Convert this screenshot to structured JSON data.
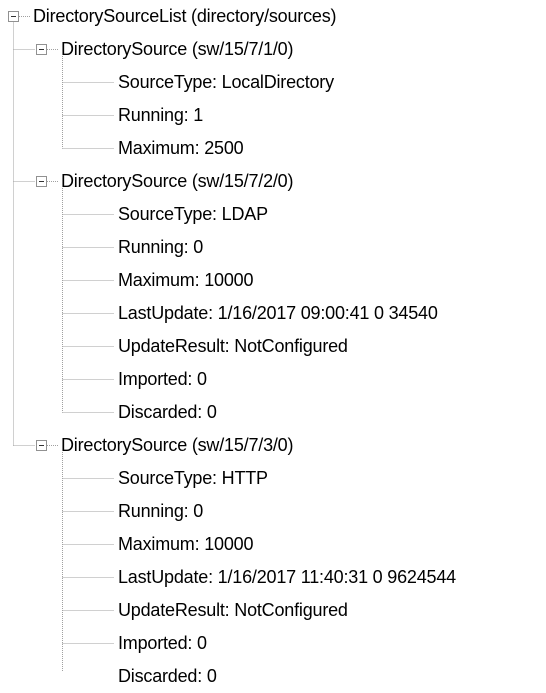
{
  "tree": {
    "root": {
      "label": "DirectorySourceList (directory/sources)",
      "children": [
        {
          "label": "DirectorySource (sw/15/7/1/0)",
          "children": [
            "SourceType: LocalDirectory",
            "Running: 1",
            "Maximum: 2500"
          ]
        },
        {
          "label": "DirectorySource (sw/15/7/2/0)",
          "children": [
            "SourceType: LDAP",
            "Running: 0",
            "Maximum: 10000",
            "LastUpdate: 1/16/2017 09:00:41 0 34540",
            "UpdateResult: NotConfigured",
            "Imported: 0",
            "Discarded: 0"
          ]
        },
        {
          "label": "DirectorySource (sw/15/7/3/0)",
          "children": [
            "SourceType: HTTP",
            "Running: 0",
            "Maximum: 10000",
            "LastUpdate: 1/16/2017 11:40:31 0 9624544",
            "UpdateResult: NotConfigured",
            "Imported: 0",
            "Discarded: 0"
          ]
        }
      ]
    }
  },
  "colors": {
    "guide_line": "#a0a0a0",
    "toggle_border": "#919191",
    "text": "#000000",
    "background": "#ffffff"
  },
  "icons": {
    "expanded_toggle": "minus-box-icon"
  }
}
